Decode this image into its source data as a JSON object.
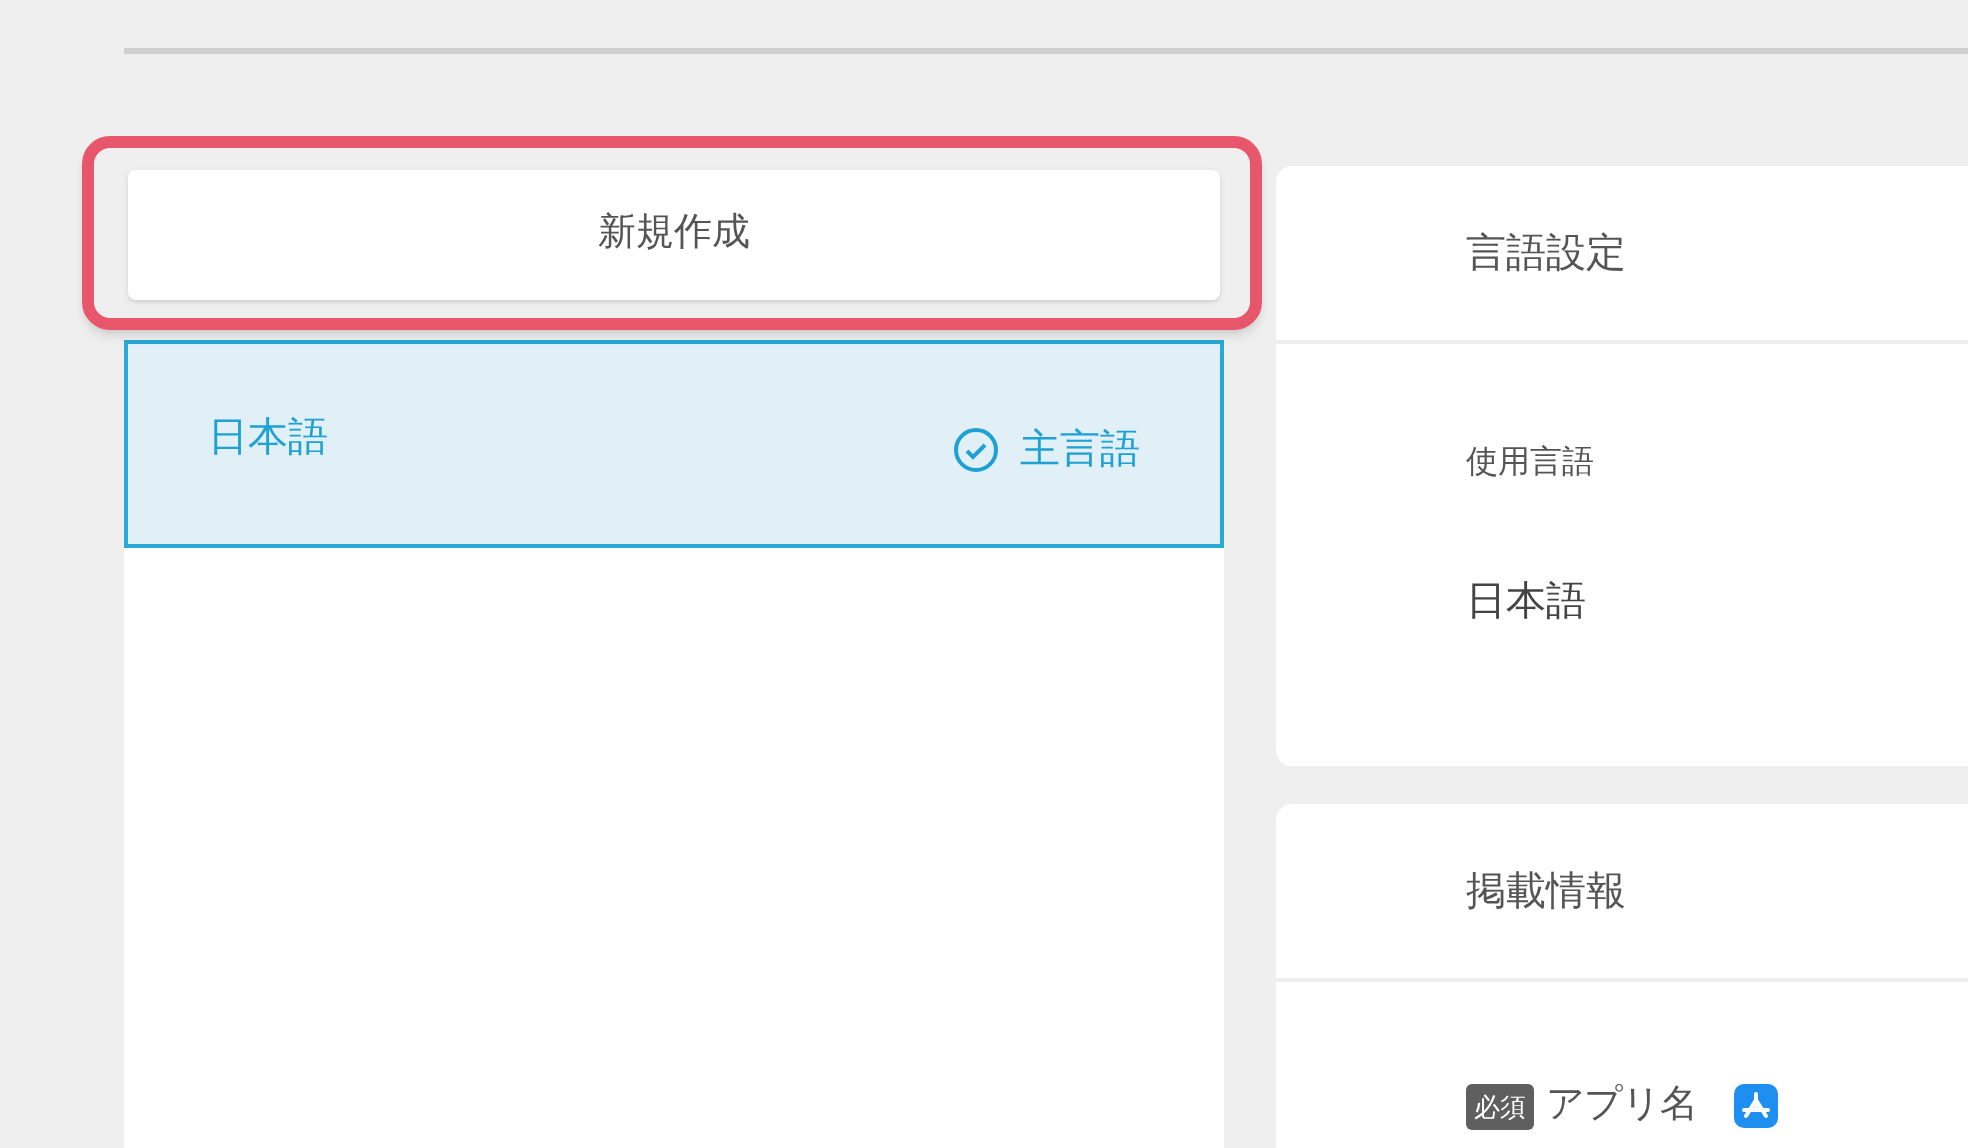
{
  "new_button": {
    "label": "新規作成",
    "highlighted": true
  },
  "languages": [
    {
      "name": "日本語",
      "selected": true,
      "primary": true,
      "primary_label": "主言語"
    }
  ],
  "panels": [
    {
      "title": "言語設定",
      "fields": [
        {
          "kind": "value",
          "label": "使用言語",
          "value": "日本語"
        }
      ]
    },
    {
      "title": "掲載情報",
      "fields": [
        {
          "kind": "required",
          "badge": "必須",
          "label": "アプリ名"
        }
      ]
    }
  ]
}
